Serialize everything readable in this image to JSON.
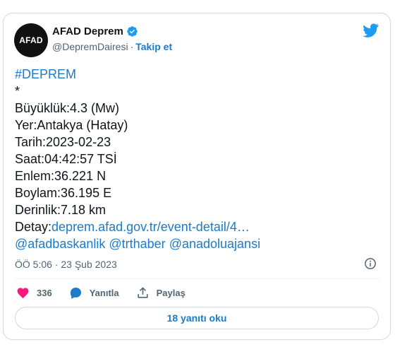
{
  "account": {
    "avatar_text": "AFAD",
    "name": "AFAD Deprem",
    "handle": "@DepremDairesi",
    "separator": "·",
    "follow_label": "Takip et"
  },
  "tweet": {
    "lines": [
      "#DEPREM",
      "*",
      "Büyüklük:4.3 (Mw)",
      "Yer:Antakya (Hatay)",
      "Tarih:2023-02-23",
      "Saat:04:42:57 TSİ",
      "Enlem:36.221 N",
      "Boylam:36.195 E",
      "Derinlik:7.18 km"
    ],
    "detail_label": "Detay:",
    "detail_link": "deprem.afad.gov.tr/event-detail/4…",
    "mentions": [
      "@afadbaskanlik",
      "@trthaber",
      "@anadoluajansi"
    ],
    "timestamp": "ÖÖ 5:06 · 23 Şub 2023"
  },
  "actions": {
    "likes": "336",
    "reply_label": "Yanıtla",
    "share_label": "Paylaş"
  },
  "read_replies_label": "18 yanıtı oku",
  "colors": {
    "accent": "#1d7ac7",
    "twitter_blue": "#1d9bf0",
    "heart": "#f91880",
    "text": "#0f1419",
    "muted": "#536471"
  },
  "icons": [
    "verified-badge-icon",
    "twitter-bird-icon",
    "info-icon",
    "heart-icon",
    "reply-bubble-icon",
    "share-icon"
  ]
}
